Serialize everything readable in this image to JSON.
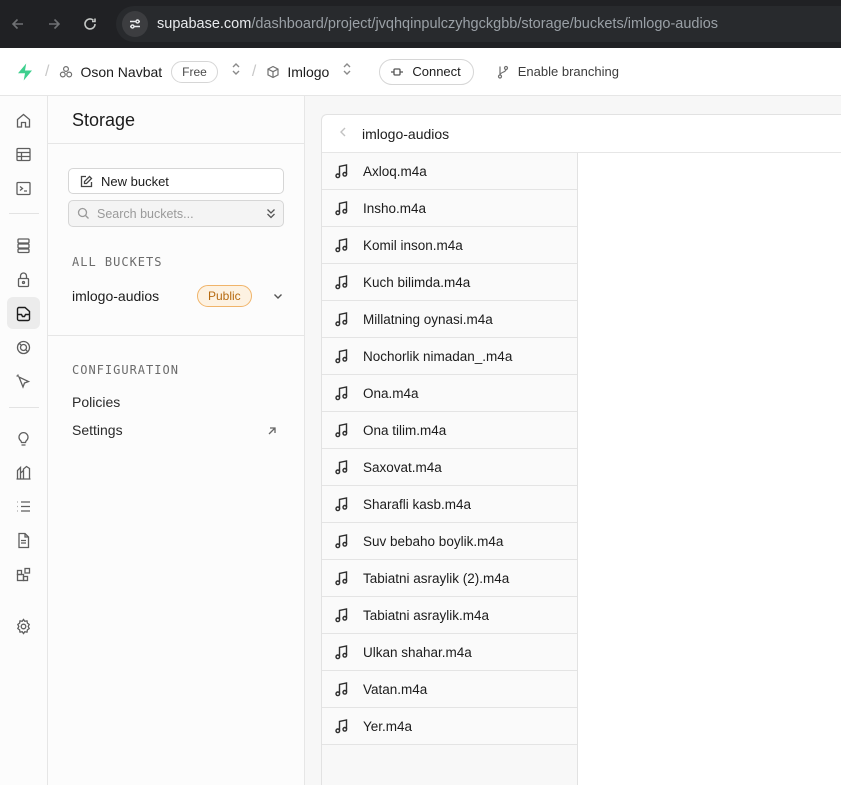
{
  "browser": {
    "url_host": "supabase.com",
    "url_path": "/dashboard/project/jvqhqinpulczyhgckgbb/storage/buckets/imlogo-audios"
  },
  "header": {
    "org_name": "Oson Navbat",
    "plan_badge": "Free",
    "project_name": "Imlogo",
    "connect_label": "Connect",
    "branching_label": "Enable branching",
    "brand_color": "#3ecf8e"
  },
  "sidebar": {
    "title": "Storage",
    "new_bucket_label": "New bucket",
    "search_placeholder": "Search buckets...",
    "all_buckets_label": "ALL BUCKETS",
    "buckets": [
      {
        "name": "imlogo-audios",
        "badge": "Public"
      }
    ],
    "configuration_label": "CONFIGURATION",
    "config_items": [
      {
        "label": "Policies"
      },
      {
        "label": "Settings"
      }
    ]
  },
  "explorer": {
    "bucket_title": "imlogo-audios",
    "files": [
      "Axloq.m4a",
      "Insho.m4a",
      "Komil inson.m4a",
      "Kuch bilimda.m4a",
      "Millatning oynasi.m4a",
      "Nochorlik nimadan_.m4a",
      "Ona.m4a",
      "Ona tilim.m4a",
      "Saxovat.m4a",
      "Sharafli kasb.m4a",
      "Suv bebaho boylik.m4a",
      "Tabiatni asraylik (2).m4a",
      "Tabiatni asraylik.m4a",
      "Ulkan shahar.m4a",
      "Vatan.m4a",
      "Yer.m4a"
    ],
    "file_icon": "music-note-icon"
  }
}
